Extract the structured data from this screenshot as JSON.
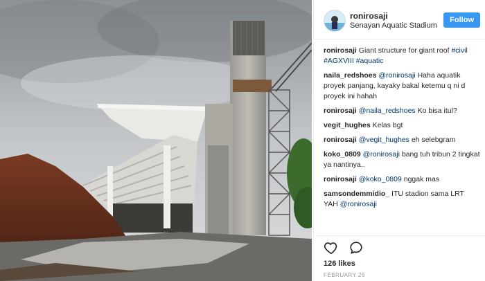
{
  "post": {
    "username": "ronirosaji",
    "location": "Senayan Aquatic Stadium",
    "follow_label": "Follow",
    "likes": "126 likes",
    "date": "FEBRUARY 26"
  },
  "caption": {
    "user": "ronirosaji",
    "text": "Giant structure for giant roof",
    "tags": [
      "#civil",
      "#AGXVIII",
      "#aquatic"
    ]
  },
  "comments": [
    {
      "user": "naila_redshoes",
      "mention": "@ronirosaji",
      "text": "Haha aquatik proyek panjang, kayaky bakal ketemu q ni d proyek ini hahah"
    },
    {
      "user": "ronirosaji",
      "mention": "@naila_redshoes",
      "text": "Ko bisa itul?"
    },
    {
      "user": "vegit_hughes",
      "mention": "",
      "text": "Kelas bgt"
    },
    {
      "user": "ronirosaji",
      "mention": "@vegit_hughes",
      "text": "eh selebgram"
    },
    {
      "user": "koko_0809",
      "mention": "@ronirosaji",
      "text": "bang tuh tribun 2 tingkat ya nantinya.."
    },
    {
      "user": "ronirosaji",
      "mention": "@koko_0809",
      "text": "nggak mas"
    },
    {
      "user": "samsondemmidio_",
      "mention": "",
      "text": "ITU stadion sama LRT YAH",
      "trailing_mention": "@ronirosaji"
    }
  ],
  "icons": {
    "like": "heart-icon",
    "comment": "comment-bubble-icon"
  },
  "colors": {
    "follow_button": "#3897f0",
    "hashtag": "#003569",
    "text": "#262626",
    "muted": "#999999"
  }
}
